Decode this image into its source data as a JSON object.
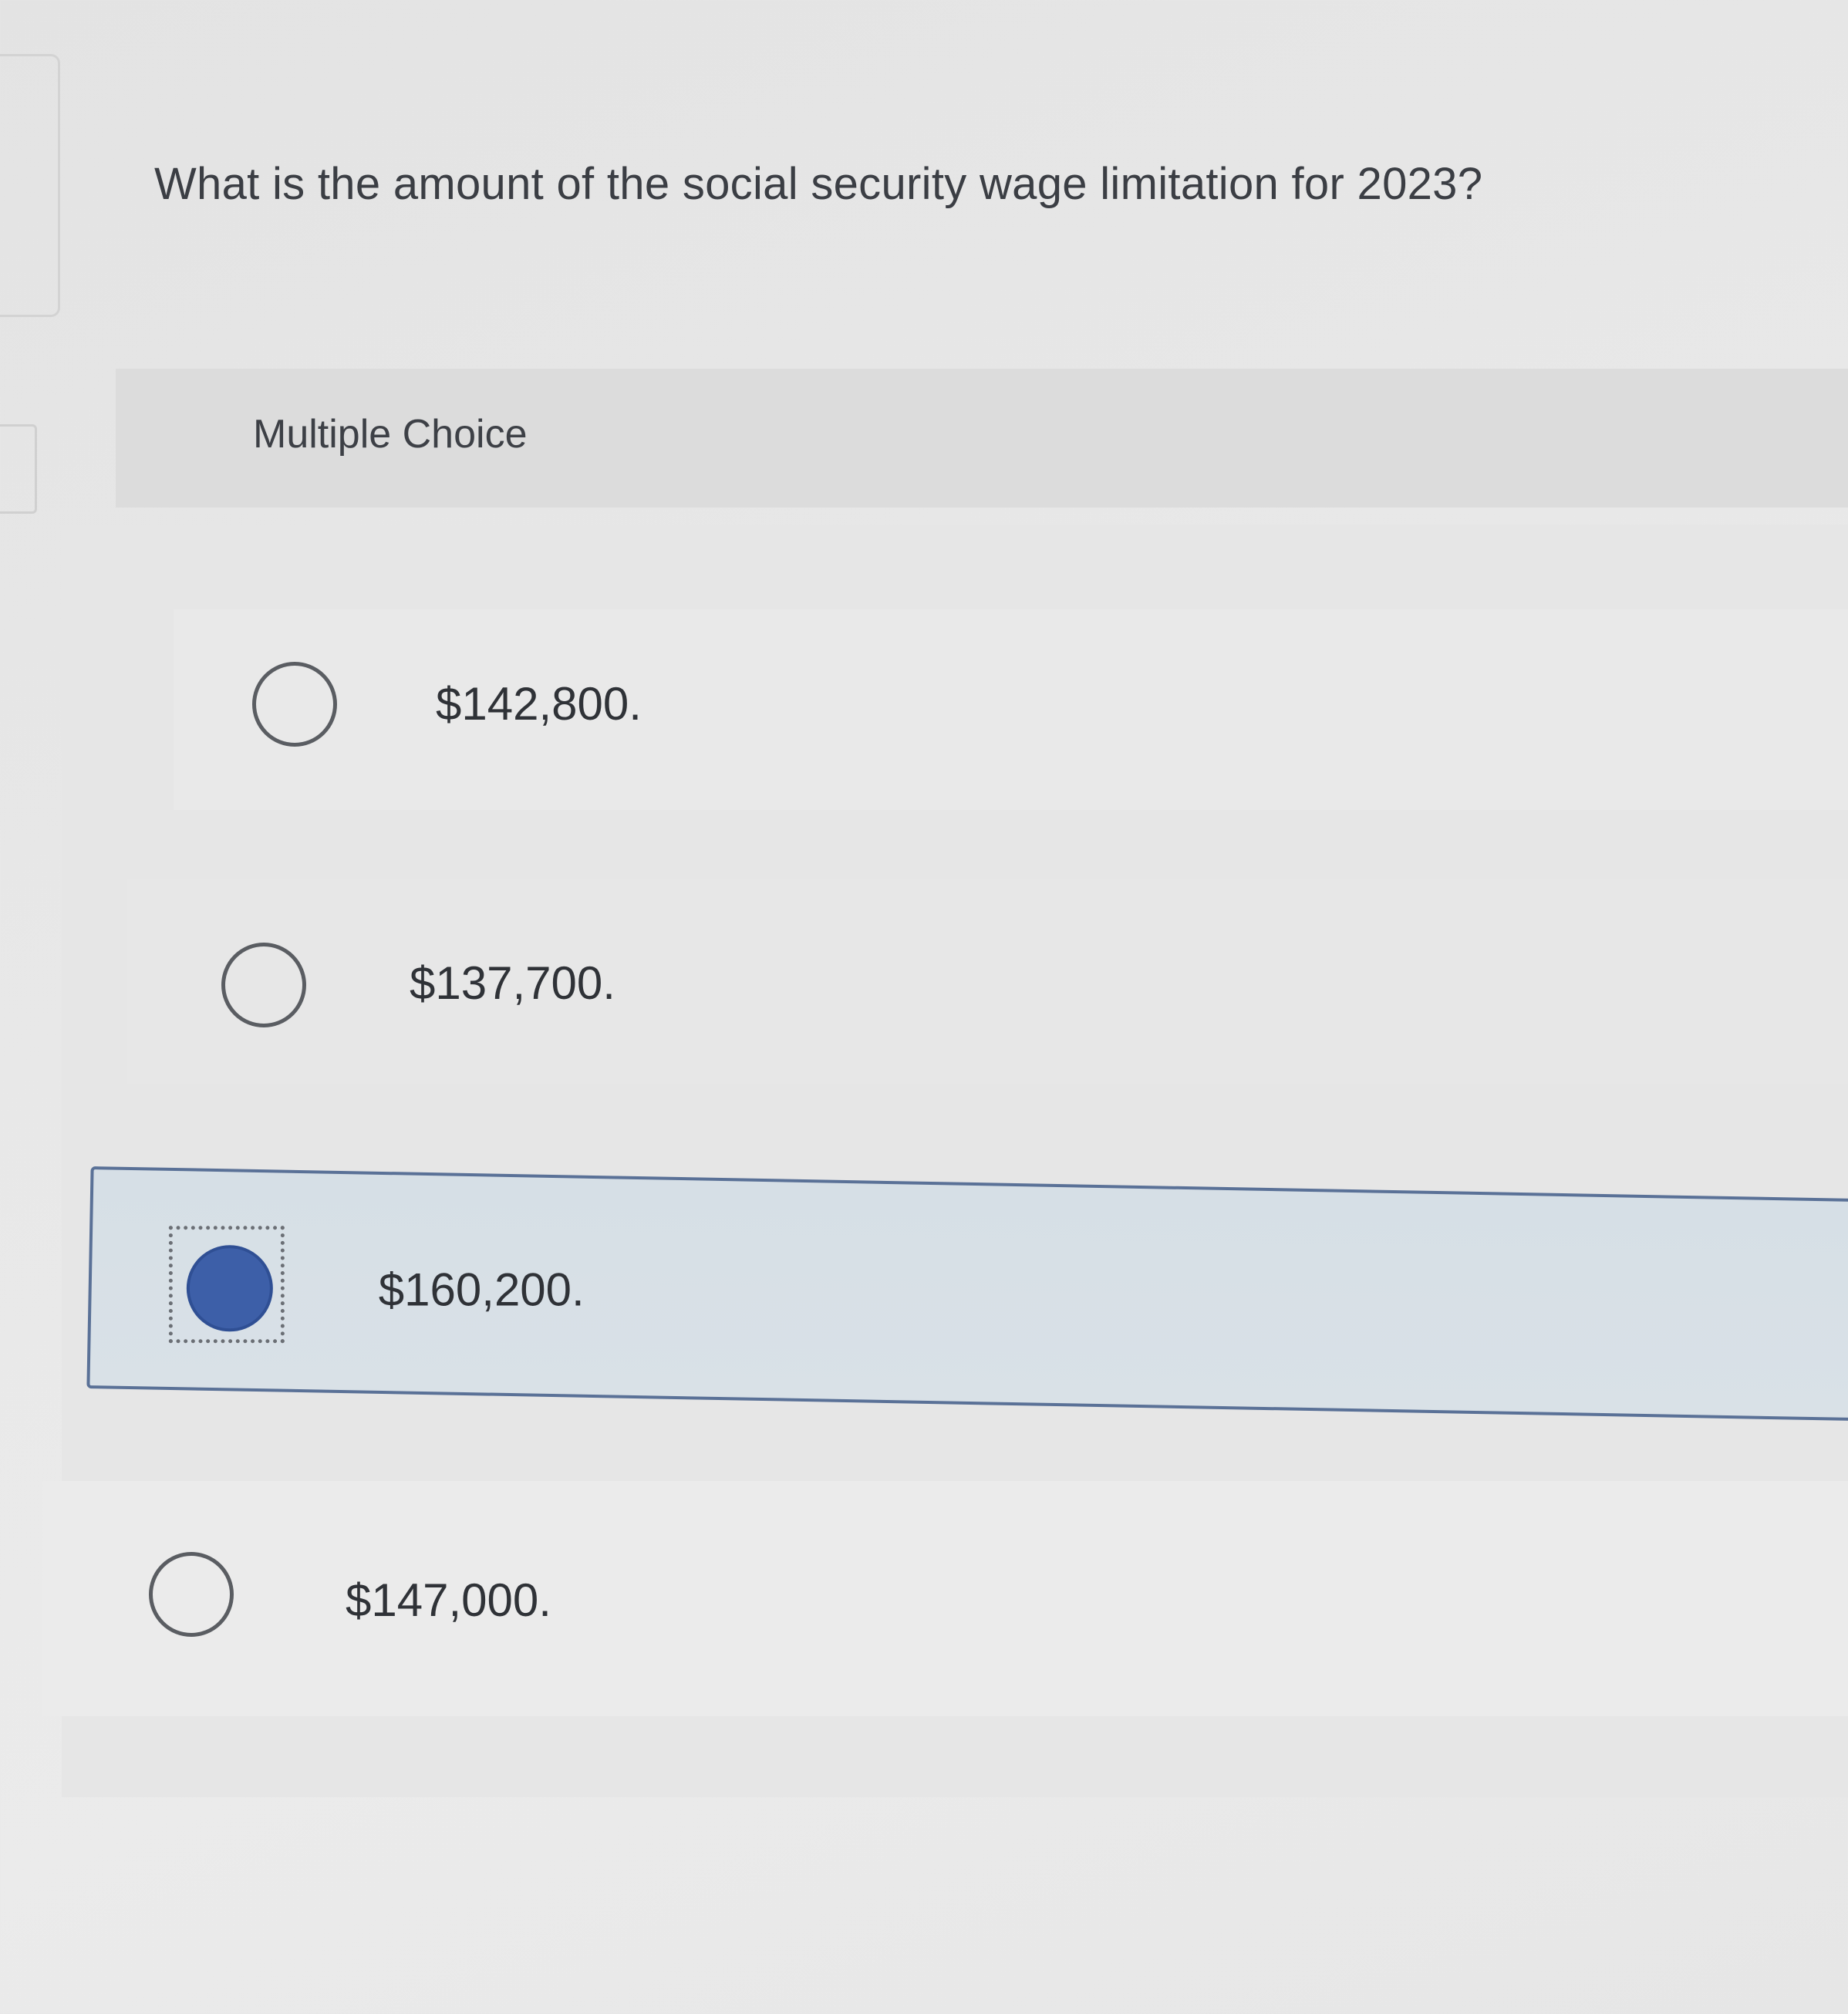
{
  "question": {
    "text": "What is the amount of the social security wage limitation for 2023?"
  },
  "section": {
    "label": "Multiple Choice"
  },
  "choices": [
    {
      "label": "$142,800.",
      "selected": false
    },
    {
      "label": "$137,700.",
      "selected": false
    },
    {
      "label": "$160,200.",
      "selected": true
    },
    {
      "label": "$147,000.",
      "selected": false
    }
  ],
  "colors": {
    "selected_radio": "#3d5fa8",
    "selected_row_border": "#5a7197",
    "selected_row_background": "#d6dfe6"
  }
}
